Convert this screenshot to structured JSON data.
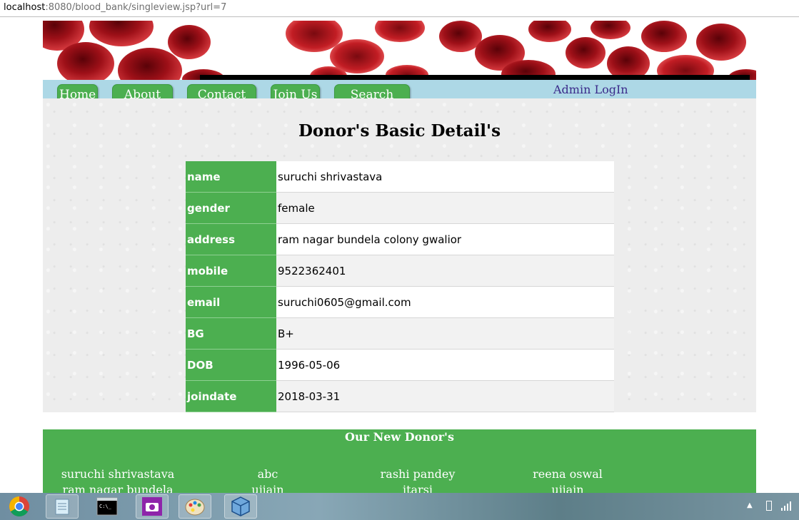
{
  "browser": {
    "url_host": "localhost",
    "url_path": ":8080/blood_bank/singleview.jsp?url=7"
  },
  "nav": {
    "home": "Home",
    "about": "About Us",
    "contact": "Contact Us",
    "join": "Join Us",
    "search": "Search Now",
    "admin": "Admin LogIn"
  },
  "page": {
    "heading": "Donor's Basic Detail's"
  },
  "details": [
    {
      "key": "name",
      "value": "suruchi shrivastava"
    },
    {
      "key": "gender",
      "value": "female"
    },
    {
      "key": "address",
      "value": "ram nagar bundela colony gwalior"
    },
    {
      "key": "mobile",
      "value": "9522362401"
    },
    {
      "key": "email",
      "value": "suruchi0605@gmail.com"
    },
    {
      "key": "BG",
      "value": "B+"
    },
    {
      "key": "DOB",
      "value": "1996-05-06"
    },
    {
      "key": "joindate",
      "value": "2018-03-31"
    }
  ],
  "footer": {
    "title": "Our New Donor's",
    "donors": [
      {
        "name": "suruchi shrivastava",
        "place": "ram nagar bundela"
      },
      {
        "name": "abc",
        "place": "ujjain"
      },
      {
        "name": "rashi pandey",
        "place": "itarsi"
      },
      {
        "name": "reena oswal",
        "place": "ujjain"
      }
    ]
  },
  "taskbar": {
    "apps": [
      "chrome-icon",
      "notepad-icon",
      "cmd-icon",
      "camera-icon",
      "paint-icon",
      "virtualbox-icon"
    ]
  },
  "colors": {
    "accent_green": "#4caf50",
    "nav_blue": "#add8e6",
    "blood_red": "#b0141c"
  }
}
